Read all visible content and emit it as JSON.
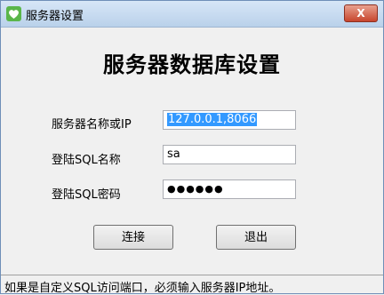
{
  "window": {
    "title": "服务器设置",
    "close_label": "X"
  },
  "heading": "服务器数据库设置",
  "form": {
    "server_label": "服务器名称或IP",
    "server_value": "127.0.0.1,8066",
    "user_label": "登陆SQL名称",
    "user_value": "sa",
    "password_label": "登陆SQL密码",
    "password_value": "●●●●●●"
  },
  "buttons": {
    "connect_label": "连接",
    "exit_label": "退出"
  },
  "status_text": "如果是自定义SQL访问端口，必须输入服务器IP地址。",
  "icons": {
    "app": "heart-icon",
    "close": "close-icon"
  }
}
